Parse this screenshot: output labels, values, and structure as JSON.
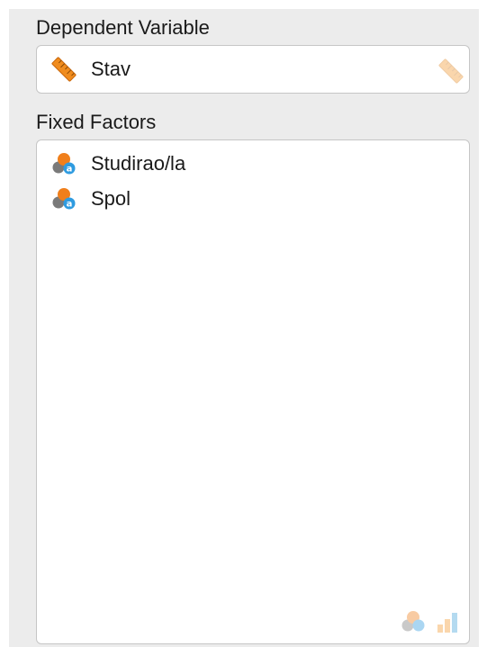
{
  "dependent_variable": {
    "label": "Dependent Variable",
    "item": {
      "name": "Stav",
      "icon": "ruler-icon"
    },
    "allowed_type_icon": "ruler-icon"
  },
  "fixed_factors": {
    "label": "Fixed Factors",
    "items": [
      {
        "name": "Studirao/la",
        "icon": "nominal-text-icon"
      },
      {
        "name": "Spol",
        "icon": "nominal-text-icon"
      }
    ],
    "allowed_type_icons": [
      "nominal-icon",
      "ordinal-icon"
    ]
  },
  "colors": {
    "panel_bg": "#ececec",
    "box_border": "#c6c6c6",
    "ruler_orange": "#f08c1e",
    "nominal_orange": "#f07f1b",
    "nominal_gray": "#7a7a7a",
    "text_blue": "#2e9be0"
  }
}
